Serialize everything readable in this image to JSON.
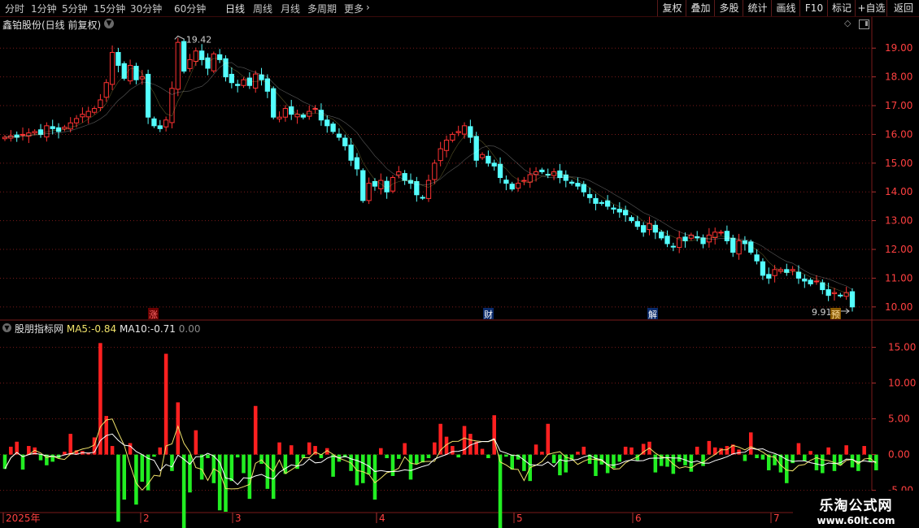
{
  "toolbar": {
    "periods": [
      "分时",
      "1分钟",
      "5分钟",
      "15分钟",
      "30分钟",
      "60分钟",
      "日线",
      "周线",
      "月线",
      "多周期",
      "更多"
    ],
    "active_period": "日线",
    "tools": [
      "复权",
      "叠加",
      "多股",
      "统计",
      "画线",
      "F10",
      "标记",
      "+自选",
      "返回"
    ]
  },
  "price_panel": {
    "title": "鑫铂股份(日线 前复权)",
    "high_label": "19.42",
    "low_label": "9.91",
    "event_markers": [
      "涨",
      "财",
      "解",
      "预"
    ]
  },
  "indicator_panel": {
    "name": "股朋指标网",
    "ma5_label": "MA5:",
    "ma5_value": "-0.84",
    "ma10_label": "MA10:",
    "ma10_value": "-0.71",
    "zero_value": "0.00"
  },
  "x_axis": [
    "2025年",
    "2",
    "3",
    "4",
    "5",
    "6",
    "7"
  ],
  "watermark": {
    "name": "乐淘公式网",
    "url": "www.60lt.com"
  },
  "colors": {
    "up": "#ff3232",
    "down": "#54ffff",
    "ma5": "#f0e26a",
    "ma10": "#ffffff",
    "bar_up": "#ff2020",
    "bar_down": "#22ee22",
    "grid": "#7a1a1a"
  },
  "chart_data": [
    {
      "type": "candlestick",
      "title": "鑫铂股份(日线 前复权)",
      "ylim": [
        9.6,
        19.6
      ],
      "y_ticks": [
        10.0,
        11.0,
        12.0,
        13.0,
        14.0,
        15.0,
        16.0,
        17.0,
        18.0,
        19.0
      ],
      "annotations": {
        "high": 19.42,
        "low": 9.91
      },
      "close": [
        15.9,
        15.95,
        15.9,
        16.0,
        16.05,
        16.1,
        16.0,
        16.3,
        16.2,
        16.1,
        16.25,
        16.4,
        16.55,
        16.7,
        16.8,
        16.9,
        17.2,
        17.8,
        18.85,
        18.4,
        17.95,
        18.4,
        17.9,
        18.0,
        16.6,
        16.3,
        16.2,
        16.5,
        17.6,
        19.2,
        18.2,
        18.6,
        18.9,
        18.6,
        18.3,
        18.8,
        18.6,
        18.0,
        17.8,
        17.7,
        17.9,
        17.7,
        18.1,
        17.9,
        17.5,
        16.6,
        16.6,
        16.9,
        16.7,
        16.7,
        16.6,
        16.8,
        16.9,
        16.5,
        16.3,
        16.1,
        15.9,
        15.6,
        15.1,
        14.8,
        13.7,
        14.3,
        14.2,
        14.4,
        14.0,
        14.5,
        14.7,
        14.4,
        14.3,
        13.9,
        13.8,
        14.4,
        15.0,
        15.5,
        15.8,
        16.0,
        16.1,
        16.3,
        15.9,
        15.1,
        15.3,
        15.0,
        14.9,
        14.5,
        14.3,
        14.1,
        14.3,
        14.4,
        14.6,
        14.7,
        14.7,
        14.6,
        14.7,
        14.5,
        14.4,
        14.3,
        14.2,
        14.0,
        13.8,
        13.6,
        13.6,
        13.5,
        13.4,
        13.3,
        13.2,
        13.0,
        12.8,
        12.6,
        12.9,
        12.6,
        12.4,
        12.2,
        12.1,
        12.4,
        12.3,
        12.5,
        12.4,
        12.2,
        12.5,
        12.6,
        12.6,
        12.3,
        11.9,
        12.3,
        12.2,
        11.9,
        11.6,
        11.1,
        11.0,
        11.3,
        11.3,
        11.2,
        11.3,
        11.0,
        10.9,
        10.8,
        10.9,
        10.6,
        10.4,
        10.5,
        10.4,
        10.5,
        10.0
      ],
      "series": [
        {
          "name": "MA5"
        },
        {
          "name": "MA10"
        }
      ]
    },
    {
      "type": "bar",
      "ylim": [
        -8,
        17
      ],
      "y_ticks": [
        15.0,
        10.0,
        5.0,
        0.0,
        -5.0
      ],
      "values": [
        -2.0,
        1.1,
        1.8,
        -2.1,
        1.2,
        1.0,
        -0.8,
        -1.5,
        -1.0,
        -0.5,
        0.4,
        2.9,
        0.6,
        0.5,
        0.3,
        2.4,
        15.6,
        5.4,
        1.2,
        -9.4,
        -6.3,
        1.6,
        -7.0,
        -3.8,
        -5.0,
        -0.3,
        1.0,
        14.1,
        -2.3,
        7.3,
        -12.2,
        -5.3,
        3.4,
        -3.5,
        -0.5,
        -4.0,
        -7.8,
        -8.0,
        -3.7,
        -0.4,
        -2.6,
        -6.2,
        6.8,
        -1.3,
        -4.8,
        -6.2,
        1.7,
        -2.7,
        1.3,
        -2.0,
        -0.5,
        1.7,
        1.2,
        -0.5,
        0.9,
        -3.1,
        -1.0,
        -0.4,
        -2.3,
        -4.3,
        -4.0,
        -2.8,
        -6.3,
        0.9,
        -0.5,
        -3.0,
        -0.6,
        1.6,
        -3.5,
        -1.3,
        -1.1,
        -0.5,
        1.7,
        4.3,
        2.5,
        1.2,
        -0.4,
        4.0,
        2.9,
        1.8,
        0.8,
        -0.5,
        5.5,
        -12.8,
        -0.3,
        -2.1,
        -0.7,
        -2.3,
        -3.7,
        1.4,
        0.4,
        4.3,
        -1.2,
        -2.9,
        -2.5,
        -0.7,
        0.4,
        1.1,
        -1.3,
        -3.0,
        -1.4,
        -2.6,
        -1.9,
        -1.0,
        1.1,
        1.0,
        -0.8,
        1.5,
        1.8,
        -2.5,
        -1.6,
        -1.7,
        -2.7,
        -1.0,
        -1.5,
        -2.4,
        1.1,
        -1.6,
        1.9,
        1.0,
        0.9,
        1.2,
        1.4,
        0.7,
        -0.9,
        3.1,
        -0.5,
        -0.7,
        -2.2,
        -1.5,
        -2.5,
        -4.0,
        -1.2,
        1.6,
        -0.9,
        0.5,
        -2.2,
        -2.6,
        1.0,
        -2.3,
        -1.5,
        1.3,
        -1.8,
        -2.3,
        1.2,
        -1.0,
        -2.2
      ],
      "series": [
        {
          "name": "MA5"
        },
        {
          "name": "MA10"
        }
      ]
    }
  ]
}
